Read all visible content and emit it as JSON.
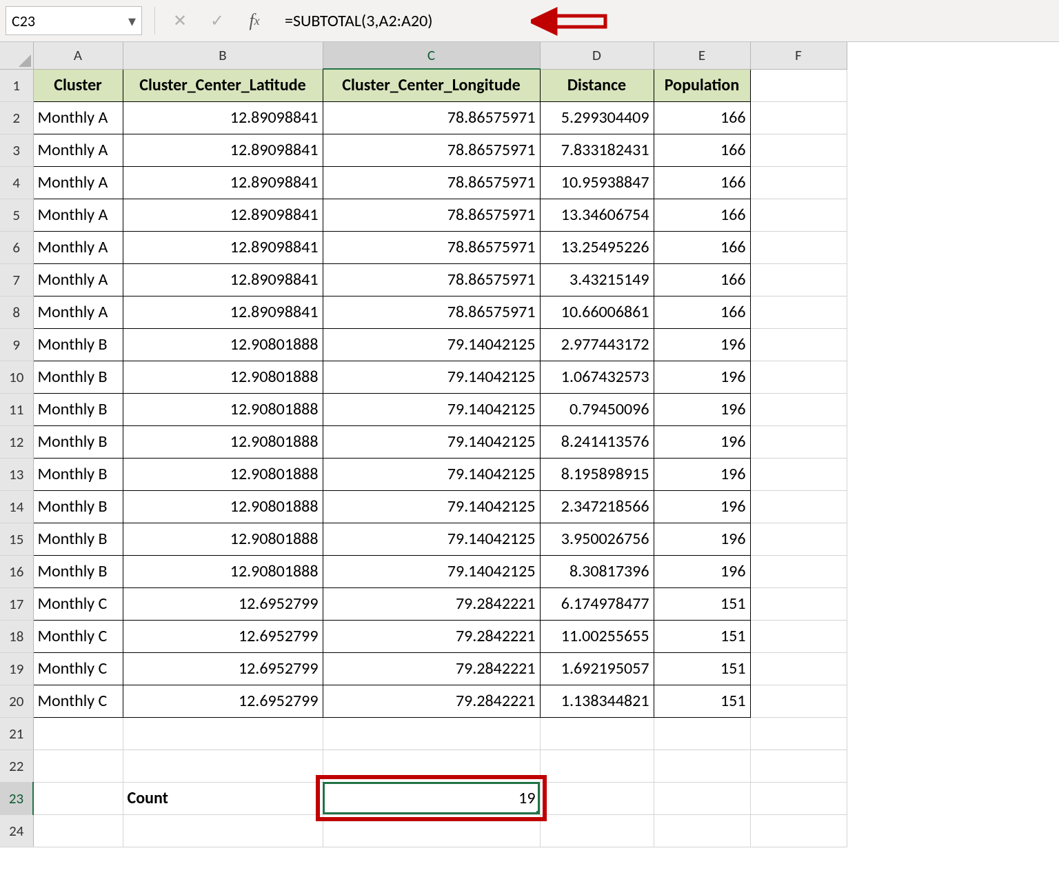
{
  "formula_bar": {
    "name_box": "C23",
    "formula": "=SUBTOTAL(3,A2:A20)"
  },
  "columns": [
    "A",
    "B",
    "C",
    "D",
    "E",
    "F"
  ],
  "row_labels": [
    "1",
    "2",
    "3",
    "4",
    "5",
    "6",
    "7",
    "8",
    "9",
    "10",
    "11",
    "12",
    "13",
    "14",
    "15",
    "16",
    "17",
    "18",
    "19",
    "20",
    "21",
    "22",
    "23",
    "24"
  ],
  "headers": {
    "A": "Cluster",
    "B": "Cluster_Center_Latitude",
    "C": "Cluster_Center_Longitude",
    "D": "Distance",
    "E": "Population"
  },
  "rows": [
    {
      "cluster": "Monthly A",
      "lat": "12.89098841",
      "lon": "78.86575971",
      "dist": "5.299304409",
      "pop": "166"
    },
    {
      "cluster": "Monthly A",
      "lat": "12.89098841",
      "lon": "78.86575971",
      "dist": "7.833182431",
      "pop": "166"
    },
    {
      "cluster": "Monthly A",
      "lat": "12.89098841",
      "lon": "78.86575971",
      "dist": "10.95938847",
      "pop": "166"
    },
    {
      "cluster": "Monthly A",
      "lat": "12.89098841",
      "lon": "78.86575971",
      "dist": "13.34606754",
      "pop": "166"
    },
    {
      "cluster": "Monthly A",
      "lat": "12.89098841",
      "lon": "78.86575971",
      "dist": "13.25495226",
      "pop": "166"
    },
    {
      "cluster": "Monthly A",
      "lat": "12.89098841",
      "lon": "78.86575971",
      "dist": "3.43215149",
      "pop": "166"
    },
    {
      "cluster": "Monthly A",
      "lat": "12.89098841",
      "lon": "78.86575971",
      "dist": "10.66006861",
      "pop": "166"
    },
    {
      "cluster": "Monthly B",
      "lat": "12.90801888",
      "lon": "79.14042125",
      "dist": "2.977443172",
      "pop": "196"
    },
    {
      "cluster": "Monthly B",
      "lat": "12.90801888",
      "lon": "79.14042125",
      "dist": "1.067432573",
      "pop": "196"
    },
    {
      "cluster": "Monthly B",
      "lat": "12.90801888",
      "lon": "79.14042125",
      "dist": "0.79450096",
      "pop": "196"
    },
    {
      "cluster": "Monthly B",
      "lat": "12.90801888",
      "lon": "79.14042125",
      "dist": "8.241413576",
      "pop": "196"
    },
    {
      "cluster": "Monthly B",
      "lat": "12.90801888",
      "lon": "79.14042125",
      "dist": "8.195898915",
      "pop": "196"
    },
    {
      "cluster": "Monthly B",
      "lat": "12.90801888",
      "lon": "79.14042125",
      "dist": "2.347218566",
      "pop": "196"
    },
    {
      "cluster": "Monthly B",
      "lat": "12.90801888",
      "lon": "79.14042125",
      "dist": "3.950026756",
      "pop": "196"
    },
    {
      "cluster": "Monthly B",
      "lat": "12.90801888",
      "lon": "79.14042125",
      "dist": "8.30817396",
      "pop": "196"
    },
    {
      "cluster": "Monthly C",
      "lat": "12.6952799",
      "lon": "79.2842221",
      "dist": "6.174978477",
      "pop": "151"
    },
    {
      "cluster": "Monthly C",
      "lat": "12.6952799",
      "lon": "79.2842221",
      "dist": "11.00255655",
      "pop": "151"
    },
    {
      "cluster": "Monthly C",
      "lat": "12.6952799",
      "lon": "79.2842221",
      "dist": "1.692195057",
      "pop": "151"
    },
    {
      "cluster": "Monthly C",
      "lat": "12.6952799",
      "lon": "79.2842221",
      "dist": "1.138344821",
      "pop": "151"
    }
  ],
  "summary": {
    "label": "Count",
    "value": "19"
  },
  "selected_cell": "C23"
}
